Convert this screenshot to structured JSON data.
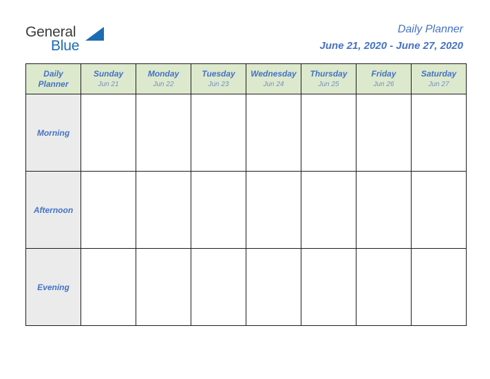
{
  "brand": {
    "name_part1": "General",
    "name_part2": "Blue",
    "triangle_color": "#1b6cb3",
    "part1_color": "#3b3b3b",
    "part2_color": "#1b6cb3"
  },
  "header": {
    "title": "Daily Planner",
    "date_range": "June 21, 2020 - June 27, 2020",
    "title_color": "#4472c4"
  },
  "table": {
    "corner": {
      "line1": "Daily",
      "line2": "Planner"
    },
    "header_background": "#dde9cd",
    "row_label_background": "#ebebeb",
    "border_color": "#1a1a1a",
    "columns": [
      {
        "day": "Sunday",
        "date": "Jun 21"
      },
      {
        "day": "Monday",
        "date": "Jun 22"
      },
      {
        "day": "Tuesday",
        "date": "Jun 23"
      },
      {
        "day": "Wednesday",
        "date": "Jun 24"
      },
      {
        "day": "Thursday",
        "date": "Jun 25"
      },
      {
        "day": "Friday",
        "date": "Jun 26"
      },
      {
        "day": "Saturday",
        "date": "Jun 27"
      }
    ],
    "rows": [
      {
        "label": "Morning",
        "cells": [
          "",
          "",
          "",
          "",
          "",
          "",
          ""
        ]
      },
      {
        "label": "Afternoon",
        "cells": [
          "",
          "",
          "",
          "",
          "",
          "",
          ""
        ]
      },
      {
        "label": "Evening",
        "cells": [
          "",
          "",
          "",
          "",
          "",
          "",
          ""
        ]
      }
    ]
  }
}
